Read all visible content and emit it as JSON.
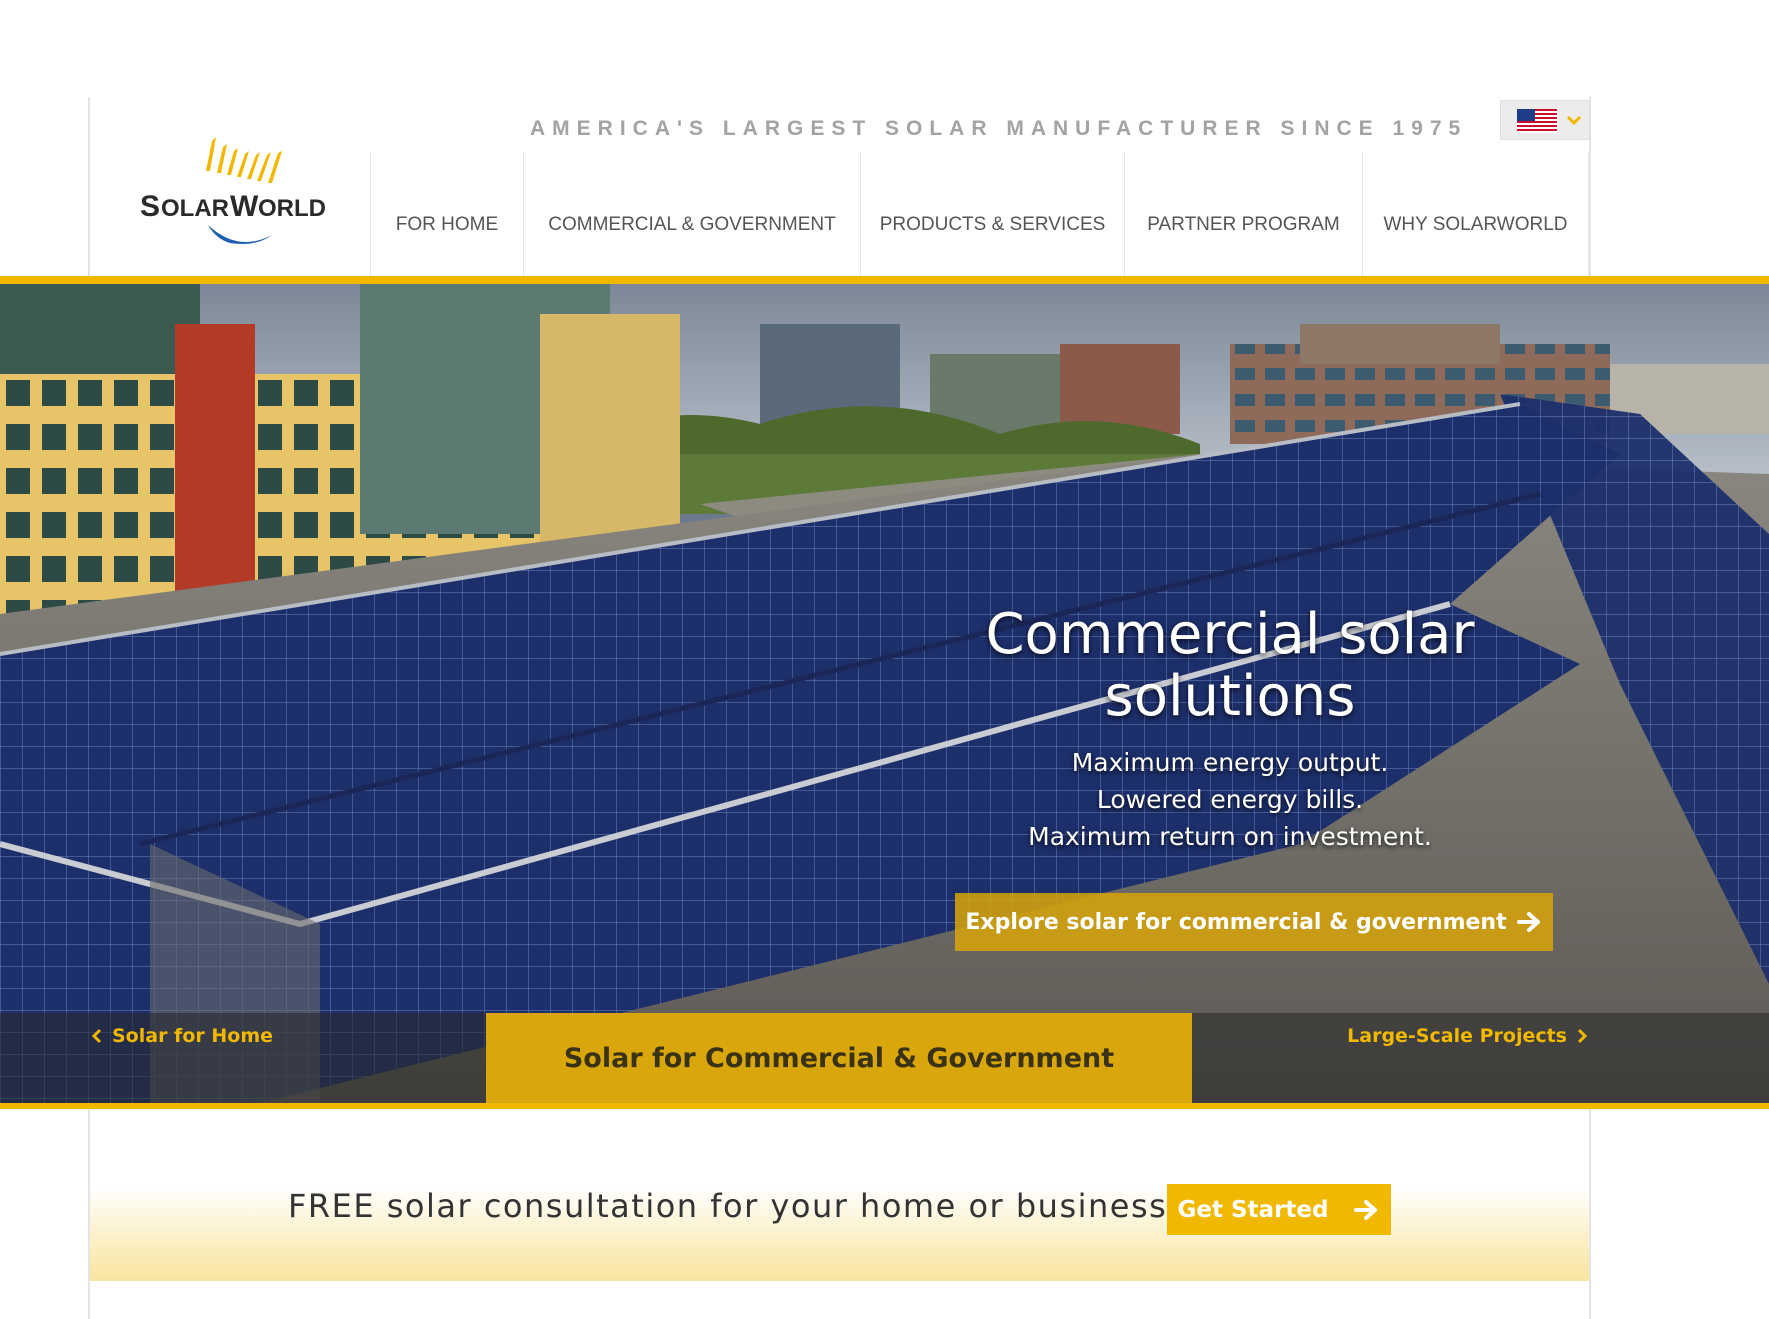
{
  "brand": {
    "logo_text": "SolarWorld",
    "tagline": "AMERICA'S LARGEST SOLAR MANUFACTURER SINCE 1975"
  },
  "language_selector": {
    "flag_icon": "us-flag-icon",
    "chevron_icon": "chevron-down-icon"
  },
  "nav": {
    "items": [
      {
        "label": "FOR HOME"
      },
      {
        "label": "COMMERCIAL & GOVERNMENT"
      },
      {
        "label": "PRODUCTS & SERVICES"
      },
      {
        "label": "PARTNER PROGRAM"
      },
      {
        "label": "WHY SOLARWORLD"
      }
    ]
  },
  "hero": {
    "title_line1": "Commercial solar",
    "title_line2": "solutions",
    "sub_line1": "Maximum energy output.",
    "sub_line2": "Lowered energy bills.",
    "sub_line3": "Maximum return on investment.",
    "cta_label": "Explore solar for commercial & government",
    "cta_icon": "arrow-right-icon"
  },
  "slider_tabs": {
    "prev_label": "Solar for Home",
    "active_label": "Solar for Commercial & Government",
    "next_label": "Large-Scale Projects"
  },
  "consultation": {
    "text": "FREE solar consultation for your home or business",
    "button_label": "Get Started",
    "button_icon": "arrow-right-icon"
  },
  "colors": {
    "accent": "#f1b800",
    "tab_active": "#d9a70c",
    "tagline": "#a3a3a3",
    "nav_text": "#555555",
    "logo_blue": "#1f5fb3"
  }
}
